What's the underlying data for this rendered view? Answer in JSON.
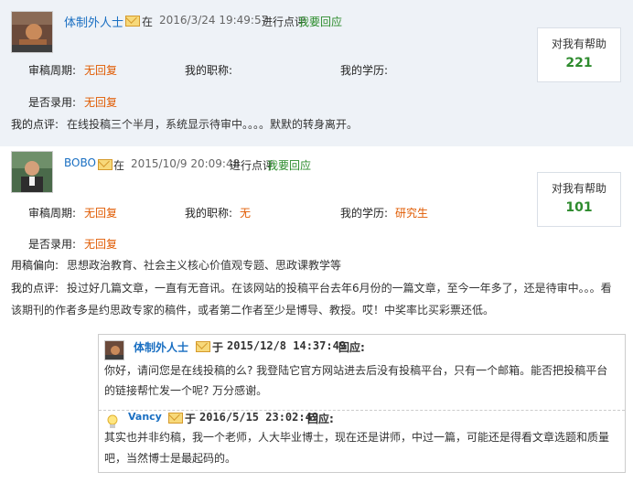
{
  "post1": {
    "username": "体制外人士",
    "on": "在",
    "datetime": "2016/3/24 19:49:57",
    "action": "进行点评",
    "reply_link": "我要回应",
    "review_period_label": "审稿周期:",
    "review_period_value": "无回复",
    "title_label": "我的职称:",
    "title_value": "",
    "edu_label": "我的学历:",
    "edu_value": "",
    "accepted_label": "是否录用:",
    "accepted_value": "无回复",
    "comment_label": "我的点评:",
    "comment_text": "在线投稿三个半月，系统显示待审中。。。。默默的转身离开。",
    "helpful_label": "对我有帮助",
    "helpful_count": "221"
  },
  "post2": {
    "username": "BOBO",
    "on": "在",
    "datetime": "2015/10/9 20:09:48",
    "action": "进行点评",
    "reply_link": "我要回应",
    "review_period_label": "审稿周期:",
    "review_period_value": "无回复",
    "title_label": "我的职称:",
    "title_value": "无",
    "edu_label": "我的学历:",
    "edu_value": "研究生",
    "accepted_label": "是否录用:",
    "accepted_value": "无回复",
    "focus_label": "用稿偏向:",
    "focus_value": "思想政治教育、社会主义核心价值观专题、思政课教学等",
    "comment_label": "我的点评:",
    "comment_line1": "投过好几篇文章，一直有无音讯。在该网站的投稿平台去年6月份的一篇文章，至今一年多了，还是待审中。。。看",
    "comment_line2": "该期刊的作者多是约思政专家的稿件，或者第二作者至少是博导、教授。哎！中奖率比买彩票还低。",
    "helpful_label": "对我有帮助",
    "helpful_count": "101"
  },
  "reply1": {
    "username": "体制外人士",
    "yu": "于",
    "datetime": "2015/12/8 14:37:49",
    "action": "回应:",
    "line1": "你好，请问您是在线投稿的么? 我登陆它官方网站进去后没有投稿平台，只有一个邮箱。能否把投稿平台",
    "line2": "的链接帮忙发一个呢? 万分感谢。"
  },
  "reply2": {
    "username": "Vancy",
    "yu": "于",
    "datetime": "2016/5/15 23:02:49",
    "action": "回应:",
    "line1": "其实也并非约稿，我一个老师，人大毕业博士，现在还是讲师，中过一篇，可能还是得看文章选题和质量",
    "line2": "吧，当然博士是最起码的。"
  }
}
